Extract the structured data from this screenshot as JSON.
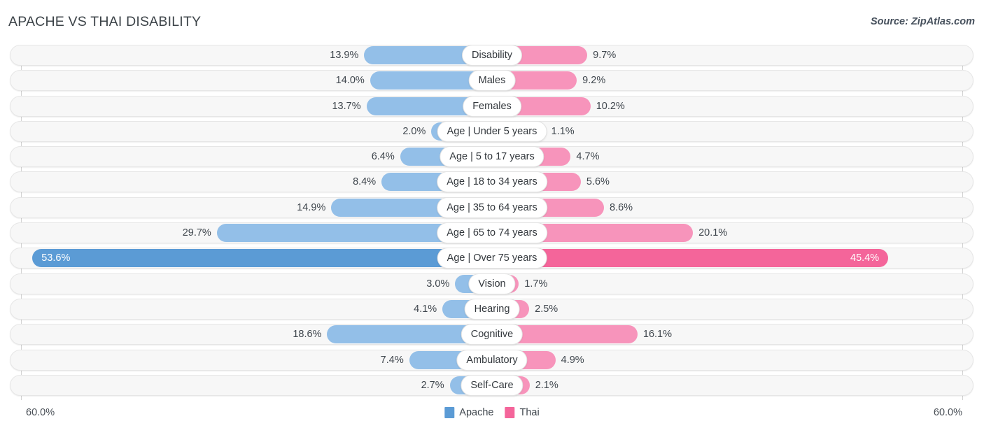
{
  "header": {
    "title": "APACHE VS THAI DISABILITY",
    "source": "Source: ZipAtlas.com"
  },
  "legend": {
    "items": [
      {
        "label": "Apache",
        "color": "#5b9bd5"
      },
      {
        "label": "Thai",
        "color": "#f4659a"
      }
    ]
  },
  "axis": {
    "left_label": "60.0%",
    "right_label": "60.0%",
    "max": 60.0
  },
  "chart_data": {
    "type": "bar",
    "orientation": "horizontal",
    "layout": "diverging-bidirectional",
    "title": "APACHE VS THAI DISABILITY",
    "subtitle": "",
    "xlabel": "",
    "ylabel": "",
    "xlim": [
      60.0,
      60.0
    ],
    "grid": false,
    "legend_position": "bottom-center",
    "categories": [
      "Disability",
      "Males",
      "Females",
      "Age | Under 5 years",
      "Age | 5 to 17 years",
      "Age | 18 to 34 years",
      "Age | 35 to 64 years",
      "Age | 65 to 74 years",
      "Age | Over 75 years",
      "Vision",
      "Hearing",
      "Cognitive",
      "Ambulatory",
      "Self-Care"
    ],
    "series": [
      {
        "name": "Apache",
        "color": "#93bfe8",
        "side": "left",
        "values": [
          13.9,
          14.0,
          13.7,
          2.0,
          6.4,
          8.4,
          14.9,
          29.7,
          53.6,
          3.0,
          4.1,
          18.6,
          7.4,
          2.7
        ],
        "labels": [
          "13.9%",
          "14.0%",
          "13.7%",
          "2.0%",
          "6.4%",
          "8.4%",
          "14.9%",
          "29.7%",
          "53.6%",
          "3.0%",
          "4.1%",
          "18.6%",
          "7.4%",
          "2.7%"
        ]
      },
      {
        "name": "Thai",
        "color": "#f794bb",
        "side": "right",
        "values": [
          9.7,
          9.2,
          10.2,
          1.1,
          4.7,
          5.6,
          8.6,
          20.1,
          45.4,
          1.7,
          2.5,
          16.1,
          4.9,
          2.1
        ],
        "labels": [
          "9.7%",
          "9.2%",
          "10.2%",
          "1.1%",
          "4.7%",
          "5.6%",
          "8.6%",
          "20.1%",
          "45.4%",
          "1.7%",
          "2.5%",
          "16.1%",
          "4.9%",
          "2.1%"
        ]
      }
    ],
    "highlight_row_index": 8
  }
}
